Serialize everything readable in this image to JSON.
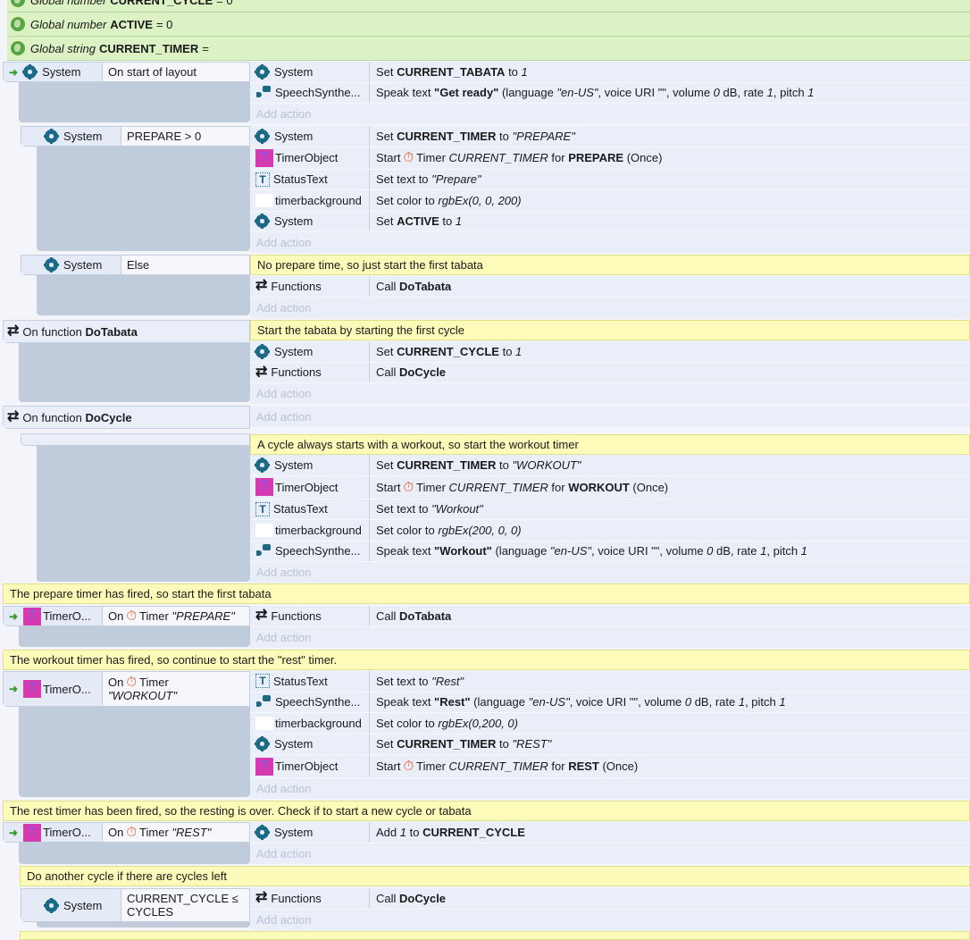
{
  "globals": [
    {
      "kind": "Global number",
      "name": "CURRENT_CYCLE",
      "value": "= 0"
    },
    {
      "kind": "Global number",
      "name": "ACTIVE",
      "value": "= 0"
    },
    {
      "kind": "Global string",
      "name": "CURRENT_TIMER",
      "value": "="
    }
  ],
  "labels": {
    "add_action": "Add action",
    "on_function": "On function",
    "on": "On",
    "timer": "Timer"
  },
  "objects": {
    "system": "System",
    "speech": "SpeechSynthe...",
    "timerobject": "TimerObject",
    "statustext": "StatusText",
    "timerbackground": "timerbackground",
    "functions": "Functions",
    "timer_short": "TimerO..."
  },
  "events": {
    "start_layout": {
      "condition": "On start of layout",
      "actions": [
        {
          "pre": "Set ",
          "bold": "CURRENT_TABATA",
          "post": " to ",
          "ital": "1"
        },
        {
          "pre": "Speak text ",
          "bold": "\"Get ready\"",
          "post": " (language ",
          "ital": "\"en-US\"",
          "rest": ", voice URI \"\", volume ",
          "i2": "0",
          "r2": " dB, rate ",
          "i3": "1",
          "r3": ", pitch ",
          "i4": "1"
        }
      ]
    },
    "prepare": {
      "condition": "PREPARE > 0",
      "actions": [
        {
          "pre": "Set ",
          "bold": "CURRENT_TIMER",
          "post": " to ",
          "ital": "\"PREPARE\""
        },
        {
          "pre": "Start",
          "timer": "Timer",
          "ital": "CURRENT_TIMER",
          "post": " for ",
          "bold": "PREPARE",
          "rest": " (Once)"
        },
        {
          "pre": "Set text to ",
          "ital": "\"Prepare\""
        },
        {
          "pre": "Set color to ",
          "ital": "rgbEx(0, 0, 200)"
        },
        {
          "pre": "Set ",
          "bold": "ACTIVE",
          "post": " to ",
          "ital": "1"
        }
      ]
    },
    "else": {
      "condition": "Else",
      "comment": "No prepare time, so just start the first tabata",
      "actions": [
        {
          "pre": "Call ",
          "bold": "DoTabata"
        }
      ]
    },
    "do_tabata": {
      "function": "DoTabata",
      "comment": "Start the tabata by starting the first cycle",
      "actions": [
        {
          "pre": "Set ",
          "bold": "CURRENT_CYCLE",
          "post": " to ",
          "ital": "1"
        },
        {
          "pre": "Call ",
          "bold": "DoCycle"
        }
      ]
    },
    "do_cycle": {
      "function": "DoCycle",
      "comment": "A cycle always starts with a workout, so start the workout timer",
      "actions": [
        {
          "pre": "Set ",
          "bold": "CURRENT_TIMER",
          "post": " to ",
          "ital": "\"WORKOUT\""
        },
        {
          "pre": "Start",
          "timer": "Timer",
          "ital": "CURRENT_TIMER",
          "post": " for ",
          "bold": "WORKOUT",
          "rest": " (Once)"
        },
        {
          "pre": "Set text to ",
          "ital": "\"Workout\""
        },
        {
          "pre": "Set color to ",
          "ital": "rgbEx(200, 0, 0)"
        },
        {
          "pre": "Speak text ",
          "bold": "\"Workout\"",
          "post": " (language ",
          "ital": "\"en-US\"",
          "rest": ", voice URI \"\", volume ",
          "i2": "0",
          "r2": " dB, rate ",
          "i3": "1",
          "r3": ", pitch ",
          "i4": "1"
        }
      ]
    },
    "on_prepare": {
      "comment": "The prepare timer has fired, so start the first tabata",
      "timer_name": "\"PREPARE\"",
      "actions": [
        {
          "pre": "Call ",
          "bold": "DoTabata"
        }
      ]
    },
    "on_workout": {
      "comment": "The workout timer has fired, so continue to start the \"rest\" timer.",
      "timer_name": "\"WORKOUT\"",
      "actions": [
        {
          "pre": "Set text to ",
          "ital": "\"Rest\""
        },
        {
          "pre": "Speak text ",
          "bold": "\"Rest\"",
          "post": " (language ",
          "ital": "\"en-US\"",
          "rest": ", voice URI \"\", volume ",
          "i2": "0",
          "r2": " dB, rate ",
          "i3": "1",
          "r3": ", pitch ",
          "i4": "1"
        },
        {
          "pre": "Set color to ",
          "ital": "rgbEx(0,200, 0)"
        },
        {
          "pre": "Set ",
          "bold": "CURRENT_TIMER",
          "post": " to ",
          "ital": "\"REST\""
        },
        {
          "pre": "Start",
          "timer": "Timer",
          "ital": "CURRENT_TIMER",
          "post": " for ",
          "bold": "REST",
          "rest": " (Once)"
        }
      ]
    },
    "on_rest": {
      "comment": "The rest timer has been fired, so the resting is over.  Check if to start a new cycle or tabata",
      "timer_name": "\"REST\"",
      "actions": [
        {
          "pre": "Add ",
          "ital": "1",
          "post": " to ",
          "bold": "CURRENT_CYCLE"
        }
      ]
    },
    "cycles_left": {
      "comment": "Do another cycle if there are cycles left",
      "condition_line1": "CURRENT_CYCLE ≤",
      "condition_line2": "CYCLES",
      "actions": [
        {
          "pre": "Call ",
          "bold": "DoCycle"
        }
      ]
    }
  }
}
